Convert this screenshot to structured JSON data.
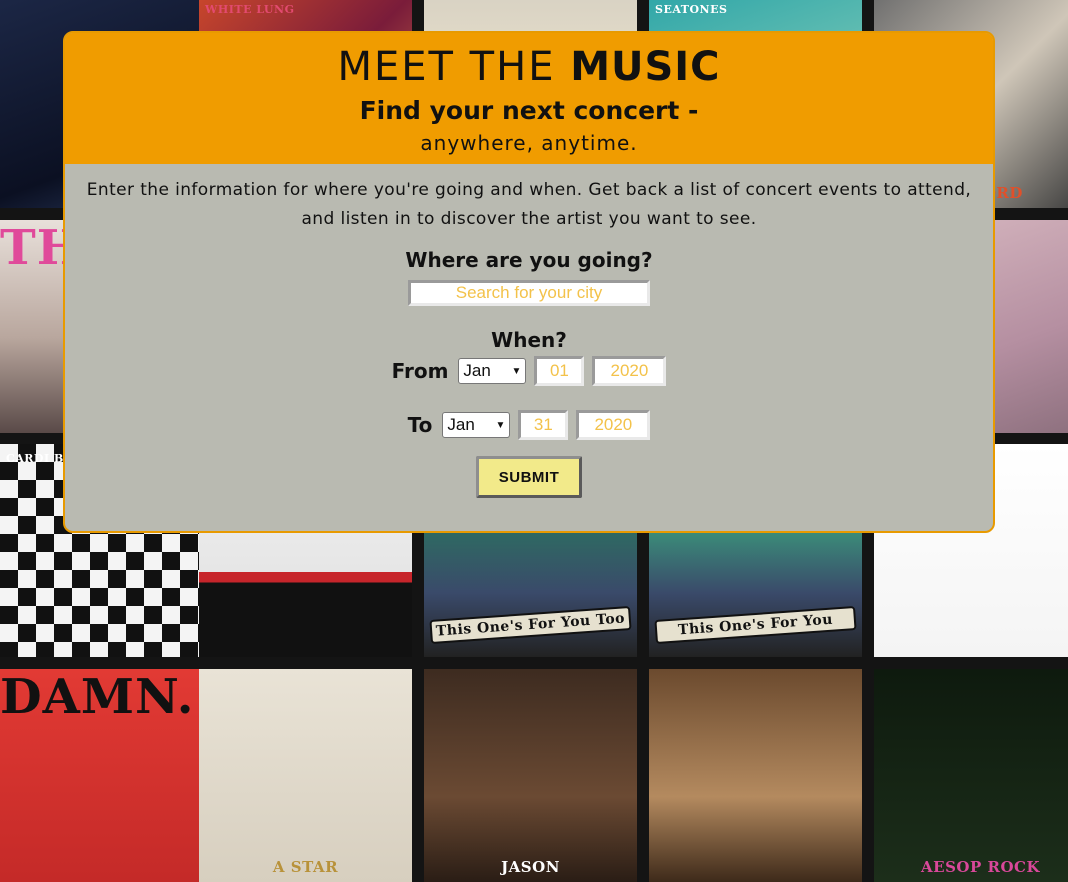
{
  "background": {
    "tiles": [
      {
        "caption": ""
      },
      {
        "caption": "WHITE LUNG"
      },
      {
        "caption": ""
      },
      {
        "caption": "SEATONES"
      },
      {
        "caption": "RIPCORD"
      },
      {
        "caption": "TH LA"
      },
      {
        "caption": ""
      },
      {
        "caption": ""
      },
      {
        "caption": ""
      },
      {
        "caption": ""
      },
      {
        "caption": "CARDI B"
      },
      {
        "caption": ""
      },
      {
        "caption": "This One's For You Too"
      },
      {
        "caption": "This One's For You"
      },
      {
        "caption": ""
      },
      {
        "caption": "DAMN."
      },
      {
        "caption": "A STAR"
      },
      {
        "caption": "JASON"
      },
      {
        "caption": ""
      },
      {
        "caption": "AESOP ROCK"
      }
    ]
  },
  "modal": {
    "title_light": "MEET THE ",
    "title_bold": "MUSIC",
    "tagline": "Find your next concert -",
    "tagline_sub": "anywhere, anytime.",
    "intro": "Enter the information for where you're going and when. Get back a list of concert events to attend, and listen in to discover the artist you want to see.",
    "where_label": "Where are you going?",
    "city_placeholder": "Search for your city",
    "when_label": "When?",
    "from": {
      "label": "From",
      "month": "Jan",
      "day": "01",
      "year": "2020"
    },
    "to": {
      "label": "To",
      "month": "Jan",
      "day": "31",
      "year": "2020"
    },
    "submit_label": "SUBMIT"
  },
  "colors": {
    "header_orange": "#f09c00",
    "panel_gray": "#b9bab1",
    "submit_yellow": "#f2ea8a",
    "placeholder_gold": "#f3c24a"
  }
}
